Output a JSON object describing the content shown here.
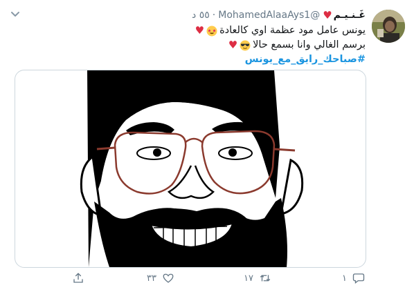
{
  "tweet": {
    "display_name": "غَـنـيـم",
    "handle": "@MohamedAlaaAys1",
    "time": "٥٥ د",
    "lines": [
      "يونس عامل مود عظمة اوي كالعادة",
      "برسم الغالي وانا بسمع حالا",
      "#صباحك_رايق_مع_يونس"
    ]
  },
  "actions": {
    "reply_count": "١",
    "retweet_count": "١٧",
    "like_count": "٣٣"
  },
  "colors": {
    "accent": "#1b95e0",
    "heart": "#dd2e44",
    "muted": "#657786"
  },
  "icons": [
    "chevron-down-icon",
    "heart-icon",
    "star-struck-emoji",
    "sunglasses-emoji",
    "reply-icon",
    "retweet-icon",
    "like-icon",
    "share-icon"
  ]
}
